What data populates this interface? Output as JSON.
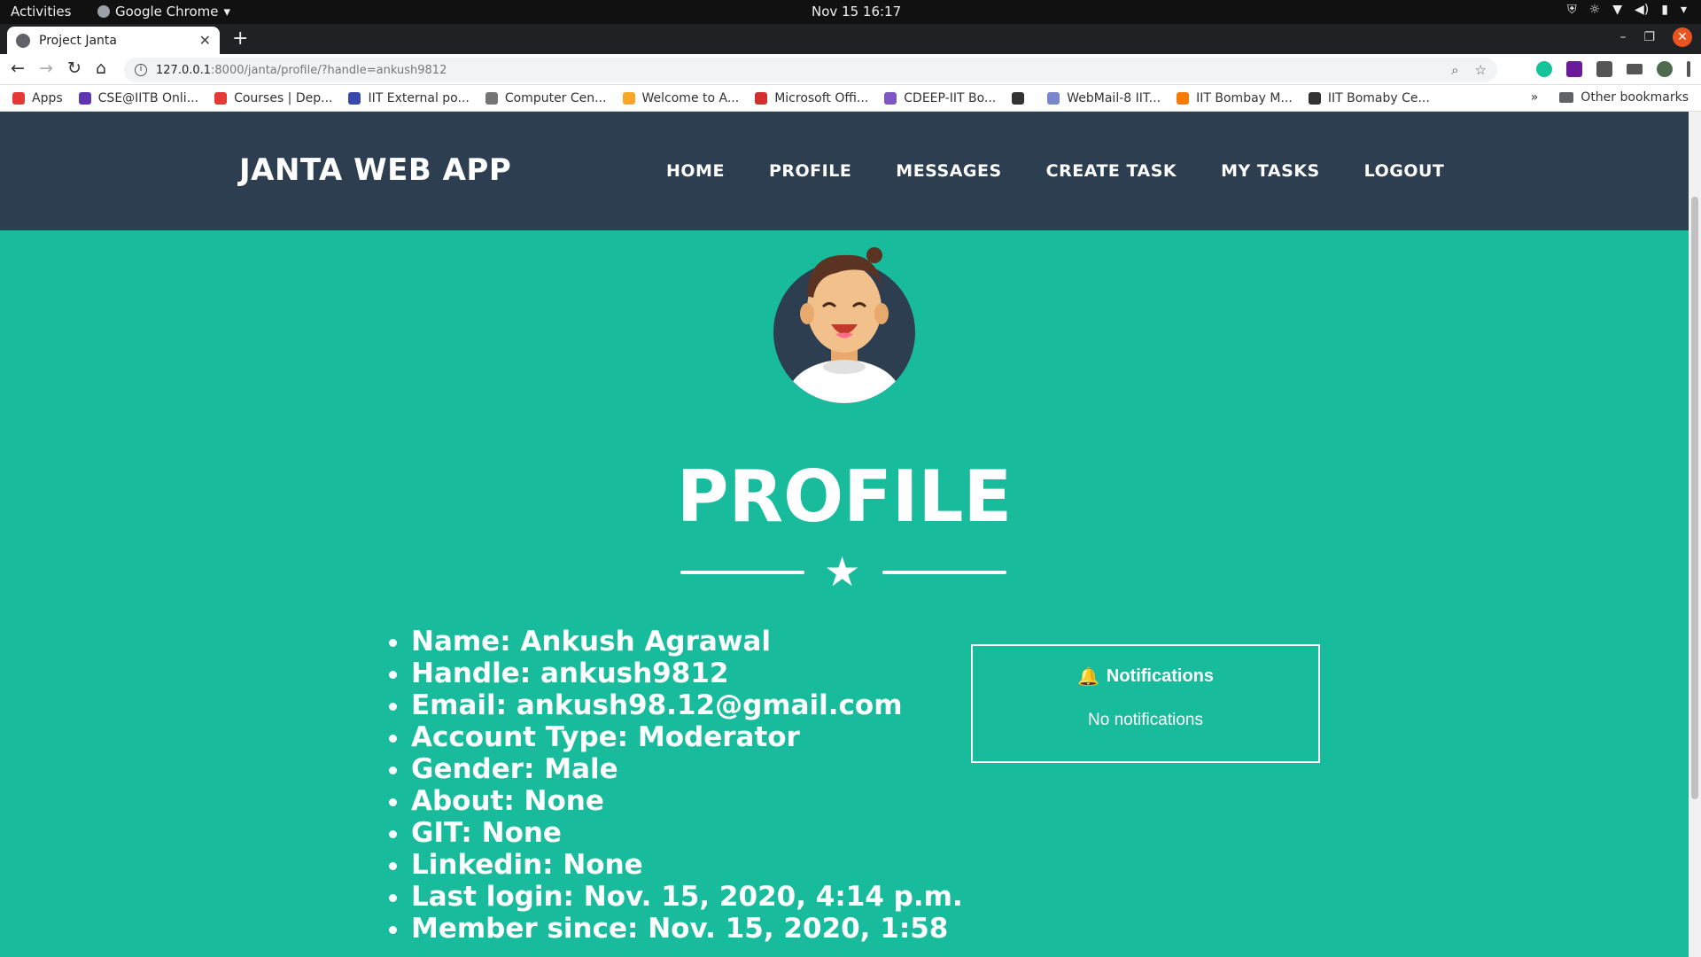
{
  "system_bar": {
    "activities": "Activities",
    "app_name": "Google Chrome",
    "clock": "Nov 15  16:17"
  },
  "browser": {
    "tab_title": "Project Janta",
    "url_host": "127.0.0.1",
    "url_rest": ":8000/janta/profile/?handle=ankush9812",
    "bookmarks": [
      {
        "label": "Apps",
        "color": "#e53935"
      },
      {
        "label": "CSE@IITB Onli...",
        "color": "#5e35b1"
      },
      {
        "label": "Courses | Dep...",
        "color": "#e53935"
      },
      {
        "label": "IIT External po...",
        "color": "#3949ab"
      },
      {
        "label": "Computer Cen...",
        "color": "#757575"
      },
      {
        "label": "Welcome to A...",
        "color": "#f9a825"
      },
      {
        "label": "Microsoft Offi...",
        "color": "#d32f2f"
      },
      {
        "label": "CDEEP-IIT Bo...",
        "color": "#7e57c2"
      },
      {
        "label": "",
        "color": "#333333"
      },
      {
        "label": "WebMail-8 IIT...",
        "color": "#7986cb"
      },
      {
        "label": "IIT Bombay M...",
        "color": "#f57c00"
      },
      {
        "label": "IIT Bomaby Ce...",
        "color": "#333333"
      }
    ],
    "other_bookmarks": "Other bookmarks"
  },
  "site": {
    "brand": "JANTA WEB APP",
    "nav": [
      "HOME",
      "PROFILE",
      "MESSAGES",
      "CREATE TASK",
      "MY TASKS",
      "LOGOUT"
    ],
    "heading": "PROFILE",
    "details": [
      "Name: Ankush Agrawal",
      "Handle: ankush9812",
      "Email: ankush98.12@gmail.com",
      "Account Type: Moderator",
      "Gender: Male",
      "About: None",
      "GIT: None",
      "Linkedin: None",
      "Last login: Nov. 15, 2020, 4:14 p.m.",
      "Member since: Nov. 15, 2020, 1:58"
    ],
    "notifications": {
      "title": "Notifications",
      "body": "No notifications"
    },
    "colors": {
      "nav_bg": "#2c3e50",
      "page_bg": "#18bc9c"
    }
  }
}
